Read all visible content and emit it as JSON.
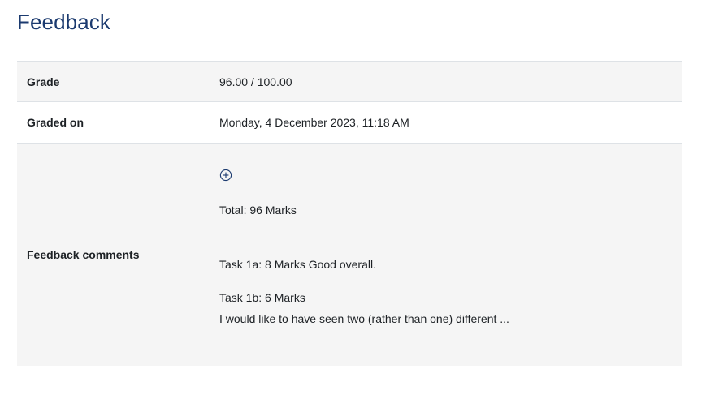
{
  "page": {
    "title": "Feedback"
  },
  "table": {
    "grade": {
      "label": "Grade",
      "value": "96.00 / 100.00"
    },
    "graded_on": {
      "label": "Graded on",
      "value": "Monday, 4 December 2023, 11:18 AM"
    },
    "feedback_comments": {
      "label": "Feedback comments",
      "expand_icon": "plus-circle-icon",
      "lines": {
        "total": "Total: 96 Marks",
        "task_1a": "Task 1a: 8 Marks Good overall.",
        "task_1b": "Task 1b: 6 Marks",
        "task_1b_note": "I would like to have seen two (rather than one) different ..."
      }
    }
  },
  "colors": {
    "title": "#1b3a6f",
    "row_shade": "#f5f5f5",
    "border": "#dee2e6",
    "icon": "#1b3a6f"
  }
}
